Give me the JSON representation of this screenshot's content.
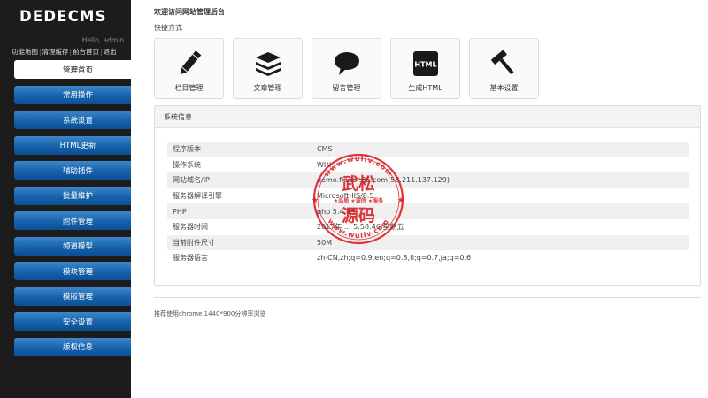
{
  "brand": {
    "logo": "DEDECMS",
    "greeting": "Hello, admin"
  },
  "top_links": [
    "功能地图",
    "清理缓存",
    "前台首页",
    "退出"
  ],
  "menu": [
    {
      "label": "管理首页",
      "active": true
    },
    {
      "label": "常用操作"
    },
    {
      "label": "系统设置"
    },
    {
      "label": "HTML更新"
    },
    {
      "label": "辅助插件"
    },
    {
      "label": "批量维护"
    },
    {
      "label": "附件管理"
    },
    {
      "label": "频道模型"
    },
    {
      "label": "模块管理"
    },
    {
      "label": "模版管理"
    },
    {
      "label": "安全设置"
    },
    {
      "label": "版权信息"
    }
  ],
  "main": {
    "welcome": "欢迎访问网站管理后台",
    "shortcut_title": "快捷方式",
    "shortcuts": [
      {
        "label": "栏目管理",
        "icon": "pencil-icon"
      },
      {
        "label": "文章管理",
        "icon": "stack-icon"
      },
      {
        "label": "留言管理",
        "icon": "chat-bubble-icon"
      },
      {
        "label": "生成HTML",
        "icon": "html-icon"
      },
      {
        "label": "基本设置",
        "icon": "hammer-icon"
      }
    ],
    "panel_title": "系统信息",
    "info": [
      {
        "k": "程序版本",
        "v": "CMS"
      },
      {
        "k": "操作系统",
        "v": "WIN"
      },
      {
        "k": "网站域名/IP",
        "v": "demo.fladdr.86.com(58.211.137.129)"
      },
      {
        "k": "服务器解译引擎",
        "v": "Microsoft-IIS/8.5"
      },
      {
        "k": "PHP",
        "v": "php 5.4.45"
      },
      {
        "k": "服务器时间",
        "v": "2017年 ... 5:58:46 星期五"
      },
      {
        "k": "当前附件尺寸",
        "v": "50M"
      },
      {
        "k": "服务器语言",
        "v": "zh-CN,zh;q=0.9,en;q=0.8,fi;q=0.7,ja;q=0.6"
      }
    ],
    "recommend": "推荐使用chrome 1440*900分辨率浏览"
  },
  "watermark": {
    "url_top": "www.wuliv.com",
    "url_bottom": "www.wuliv.com",
    "big_top": "武松",
    "middle": "★品质 ★诚信 ★服务",
    "big_bottom": "源码"
  },
  "colors": {
    "sidebar_bg": "#1c1c1c",
    "menu_blue": "#1562ab",
    "stamp_red": "#d8141b"
  }
}
